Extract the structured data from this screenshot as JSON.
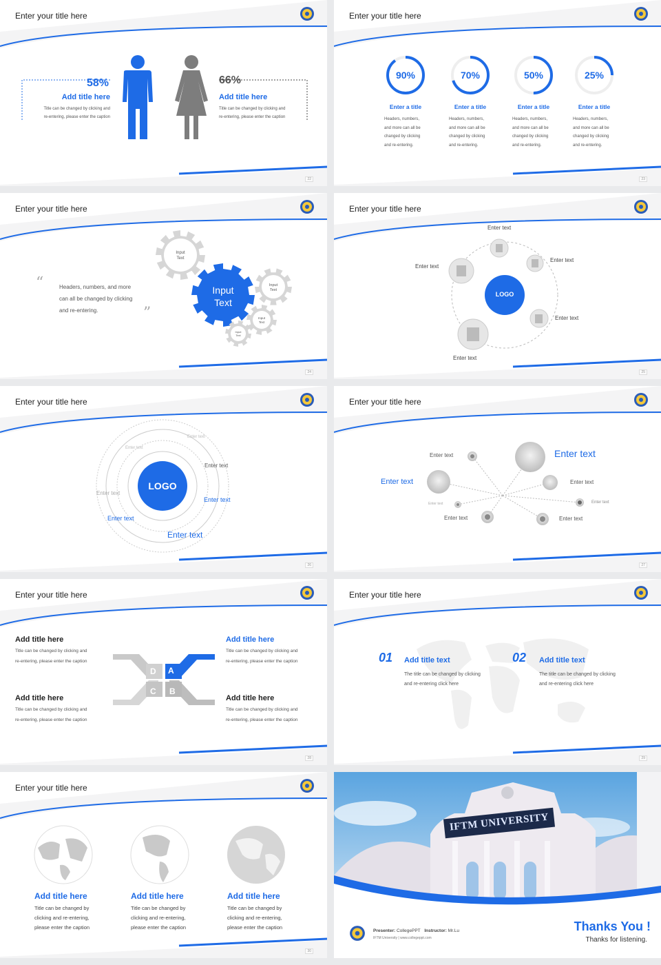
{
  "colors": {
    "accent": "#1e6be6",
    "gray": "#8a8a8a",
    "light": "#d9d9d9"
  },
  "slide_title": "Enter your title here",
  "s1": {
    "left_pct": "58%",
    "left_title": "Add title here",
    "left_caption_1": "Title can be changed by clicking and",
    "left_caption_2": "re-entering, please enter the caption",
    "right_pct": "66%",
    "right_title": "Add title here",
    "right_caption_1": "Title can be changed by clicking and",
    "right_caption_2": "re-entering, please enter the caption",
    "page": "22",
    "male_value": 0.58,
    "female_value": 0.66
  },
  "s2": {
    "items": [
      {
        "pct": "90%",
        "value": 0.9,
        "title": "Enter a title",
        "l1": "Headers, numbers,",
        "l2": "and more can all be",
        "l3": "changed by clicking",
        "l4": "and re-entering."
      },
      {
        "pct": "70%",
        "value": 0.7,
        "title": "Enter a title",
        "l1": "Headers, numbers,",
        "l2": "and more can all be",
        "l3": "changed by clicking",
        "l4": "and re-entering."
      },
      {
        "pct": "50%",
        "value": 0.5,
        "title": "Enter a title",
        "l1": "Headers, numbers,",
        "l2": "and more can all be",
        "l3": "changed by clicking",
        "l4": "and re-entering."
      },
      {
        "pct": "25%",
        "value": 0.25,
        "title": "Enter a title",
        "l1": "Headers, numbers,",
        "l2": "and more can all be",
        "l3": "changed by clicking",
        "l4": "and re-entering."
      }
    ],
    "page": "23"
  },
  "s3": {
    "quote_1": "Headers, numbers, and more",
    "quote_2": "can all be changed by clicking",
    "quote_3": "and re-entering.",
    "gear_main_1": "Input",
    "gear_main_2": "Text",
    "gear_small_1": "Input",
    "gear_small_2": "Text",
    "page": "24"
  },
  "s4": {
    "logo": "LOGO",
    "labels": [
      "Enter text",
      "Enter text",
      "Enter text",
      "Enter text",
      "Enter text"
    ],
    "page": "25"
  },
  "s5": {
    "logo": "LOGO",
    "labels": [
      "Enter text",
      "Enter text",
      "Enter text",
      "Enter text",
      "Enter text",
      "Enter text",
      "Enter text",
      "Enter text"
    ],
    "page": "26"
  },
  "s6": {
    "labels": [
      "Enter text",
      "Enter text",
      "Enter text",
      "Enter text",
      "Enter text",
      "Enter text",
      "Enter text",
      "Enter text",
      "Enter text"
    ],
    "page": "27"
  },
  "s7": {
    "blocks": [
      {
        "title": "Add title here",
        "l1": "Title can be changed by clicking and",
        "l2": "re-entering, please enter the caption"
      },
      {
        "title": "Add title here",
        "l1": "Title can be changed by clicking and",
        "l2": "re-entering, please enter the caption"
      },
      {
        "title": "Add title here",
        "l1": "Title can be changed by clicking and",
        "l2": "re-entering, please enter the caption"
      },
      {
        "title": "Add title here",
        "l1": "Title can be changed by clicking and",
        "l2": "re-entering, please enter the caption"
      }
    ],
    "letters": [
      "A",
      "B",
      "C",
      "D"
    ],
    "page": "28"
  },
  "s8": {
    "items": [
      {
        "num": "01",
        "title": "Add title text",
        "l1": "The title can be changed by clicking",
        "l2": "and re-entering click here"
      },
      {
        "num": "02",
        "title": "Add title text",
        "l1": "The title can be changed by clicking",
        "l2": "and re-entering click here"
      }
    ],
    "page": "29"
  },
  "s9": {
    "items": [
      {
        "title": "Add title here",
        "l1": "Title can be changed by",
        "l2": "clicking and re-entering,",
        "l3": "please enter the caption"
      },
      {
        "title": "Add title here",
        "l1": "Title can be changed by",
        "l2": "clicking and re-entering,",
        "l3": "please enter the caption"
      },
      {
        "title": "Add title here",
        "l1": "Title can be changed by",
        "l2": "clicking and re-entering,",
        "l3": "please enter the caption"
      }
    ],
    "page": "30"
  },
  "s10": {
    "sign": "IFTM UNIVERSITY",
    "presenter_label": "Presenter:",
    "presenter": "CollegePPT",
    "instructor_label": "Instructor:",
    "instructor": "Mr.Lu",
    "footer": "IFTM University | www.collegeppt.com",
    "thanks": "Thanks You !",
    "thanks_sub": "Thanks for listening."
  }
}
